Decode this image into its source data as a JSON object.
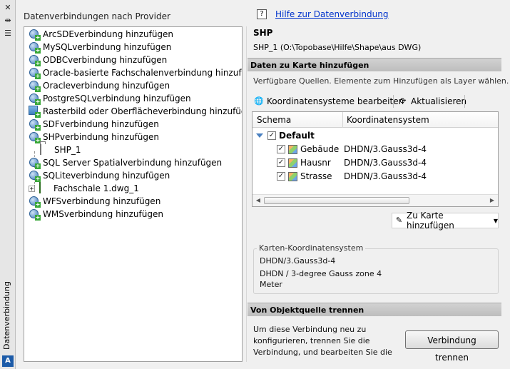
{
  "palette_title": "Datenverbindung",
  "left_panel": {
    "title": "Datenverbindungen nach Provider",
    "items": [
      {
        "label": "ArcSDEverbindung hinzufügen",
        "icon": "globe-add-icon"
      },
      {
        "label": "MySQLverbindung hinzufügen",
        "icon": "globe-add-icon"
      },
      {
        "label": "ODBCverbindung hinzufügen",
        "icon": "globe-add-icon"
      },
      {
        "label": "Oracle-basierte Fachschalenverbindung hinzufügen",
        "icon": "globe-add-icon"
      },
      {
        "label": "Oracleverbindung hinzufügen",
        "icon": "globe-add-icon"
      },
      {
        "label": "PostgreSQLverbindung hinzufügen",
        "icon": "globe-add-icon"
      },
      {
        "label": "Rasterbild oder Oberflächeverbindung hinzufügen",
        "icon": "raster-add-icon"
      },
      {
        "label": "SDFverbindung hinzufügen",
        "icon": "globe-add-icon"
      },
      {
        "label": "SHPverbindung hinzufügen",
        "icon": "globe-add-icon"
      },
      {
        "label": "SHP_1",
        "icon": "folder-icon"
      },
      {
        "label": "SQL Server Spatialverbindung hinzufügen",
        "icon": "globe-add-icon"
      },
      {
        "label": "SQLiteverbindung hinzufügen",
        "icon": "globe-add-icon"
      },
      {
        "label": "Fachschale 1.dwg_1",
        "icon": "cube-icon"
      },
      {
        "label": "WFSverbindung hinzufügen",
        "icon": "globe-add-icon"
      },
      {
        "label": "WMSverbindung hinzufügen",
        "icon": "globe-add-icon"
      }
    ]
  },
  "right_panel": {
    "help_link": "Hilfe zur Datenverbindung",
    "provider_name": "SHP",
    "provider_path": "SHP_1 (O:\\Topobase\\Hilfe\\Shape\\aus DWG)",
    "add_section_title": "Daten zu Karte hinzufügen",
    "hint": "Verfügbare Quellen. Elemente zum Hinzufügen als Layer wählen.",
    "edit_cs_label": "Koordinatensysteme bearbeiten",
    "refresh_label": "Aktualisieren",
    "grid": {
      "col_schema": "Schema",
      "col_cs": "Koordinatensystem",
      "group_label": "Default",
      "rows": [
        {
          "name": "Gebäude",
          "cs": "DHDN/3.Gauss3d-4"
        },
        {
          "name": "Hausnr",
          "cs": "DHDN/3.Gauss3d-4"
        },
        {
          "name": "Strasse",
          "cs": "DHDN/3.Gauss3d-4"
        }
      ]
    },
    "add_to_map_label": "Zu Karte hinzufügen",
    "map_cs": {
      "label": "Karten-Koordinatensystem",
      "code": "DHDN/3.Gauss3d-4",
      "description": "DHDN / 3-degree Gauss zone 4",
      "unit": "Meter"
    },
    "disconnect_section_title": "Von Objektquelle trennen",
    "disconnect_text": "Um diese Verbindung neu zu konfigurieren, trennen Sie die Verbindung, und bearbeiten Sie die",
    "disconnect_button": "Verbindung trennen"
  }
}
